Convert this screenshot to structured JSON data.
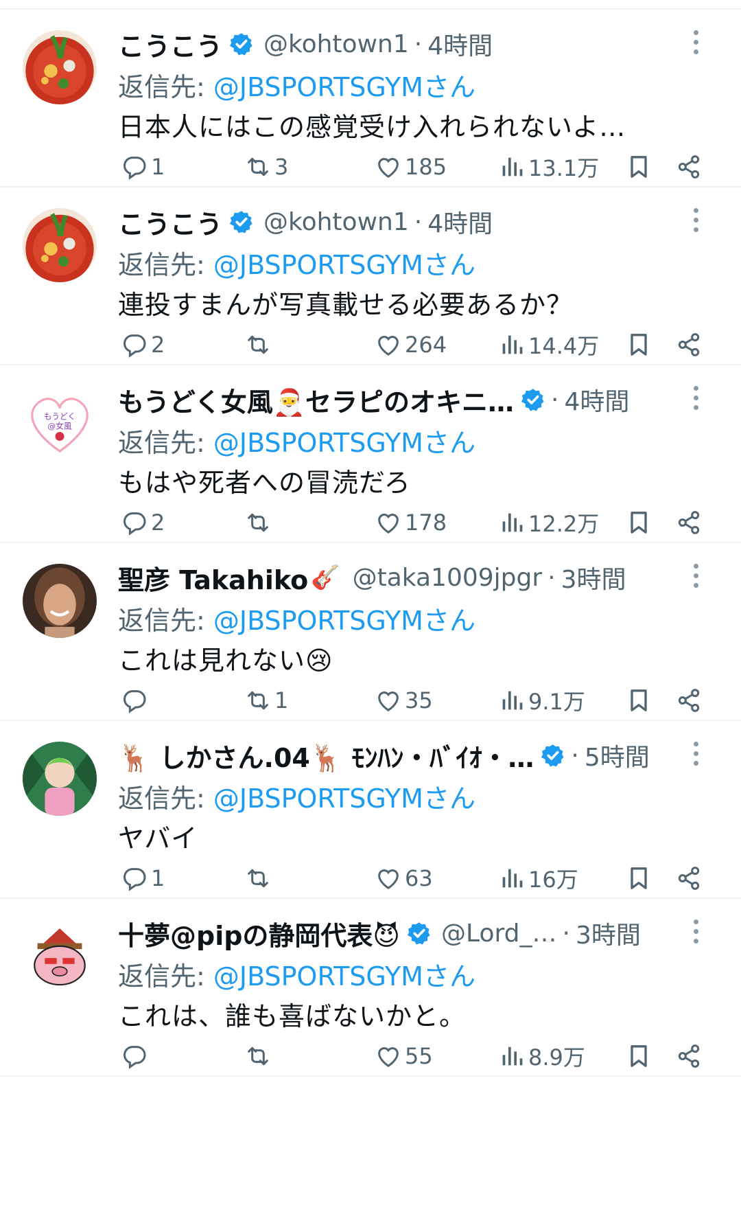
{
  "reply_prefix": "返信先: ",
  "tweets": [
    {
      "name": "こうこう",
      "name_emoji": "",
      "name_emoji2": "",
      "verified": true,
      "handle": "@kohtown1",
      "time": "4時間",
      "reply_to": "@JBSPORTSGYMさん",
      "text": "日本人にはこの感覚受け入れられないよ…",
      "replies": "1",
      "retweets": "3",
      "likes": "185",
      "views": "13.1万",
      "avatar": "food-bowl"
    },
    {
      "name": "こうこう",
      "name_emoji": "",
      "name_emoji2": "",
      "verified": true,
      "handle": "@kohtown1",
      "time": "4時間",
      "reply_to": "@JBSPORTSGYMさん",
      "text": "連投すまんが写真載せる必要あるか？",
      "replies": "2",
      "retweets": "",
      "likes": "264",
      "views": "14.4万",
      "avatar": "food-bowl"
    },
    {
      "name": "もうどく女風🎅セラピのオキニ…",
      "name_emoji": "",
      "name_emoji2": "",
      "verified": true,
      "handle": "",
      "time": "4時間",
      "reply_to": "@JBSPORTSGYMさん",
      "text": "もはや死者への冒涜だろ",
      "replies": "2",
      "retweets": "",
      "likes": "178",
      "views": "12.2万",
      "avatar": "heart-logo"
    },
    {
      "name": "聖彦 Takahiko",
      "name_emoji": "🎸",
      "name_emoji2": "",
      "verified": false,
      "handle": "@taka1009jpgr",
      "time": "3時間",
      "reply_to": "@JBSPORTSGYMさん",
      "text": "これは見れない😢",
      "replies": "",
      "retweets": "1",
      "likes": "35",
      "views": "9.1万",
      "avatar": "portrait"
    },
    {
      "name": "🦌 しかさん.04🦌 ﾓﾝﾊﾝ・ﾊﾞｲｵ・…",
      "name_emoji": "",
      "name_emoji2": "",
      "verified": true,
      "handle": "",
      "time": "5時間",
      "reply_to": "@JBSPORTSGYMさん",
      "text": "ヤバイ",
      "replies": "1",
      "retweets": "",
      "likes": "63",
      "views": "16万",
      "avatar": "anime"
    },
    {
      "name": "十夢@pipの静岡代表😈",
      "name_emoji": "",
      "name_emoji2": "",
      "verified": true,
      "handle": "@Lord_…",
      "time": "3時間",
      "reply_to": "@JBSPORTSGYMさん",
      "text": "これは、誰も喜ばないかと。",
      "replies": "",
      "retweets": "",
      "likes": "55",
      "views": "8.9万",
      "avatar": "pig-character"
    }
  ],
  "colors": {
    "accent": "#1d9bf0",
    "muted": "#536471",
    "text": "#0f1419",
    "divider": "#eff3f4"
  },
  "icons": [
    "reply-icon",
    "retweet-icon",
    "like-icon",
    "views-icon",
    "bookmark-icon",
    "share-icon",
    "more-icon",
    "verified-icon"
  ]
}
